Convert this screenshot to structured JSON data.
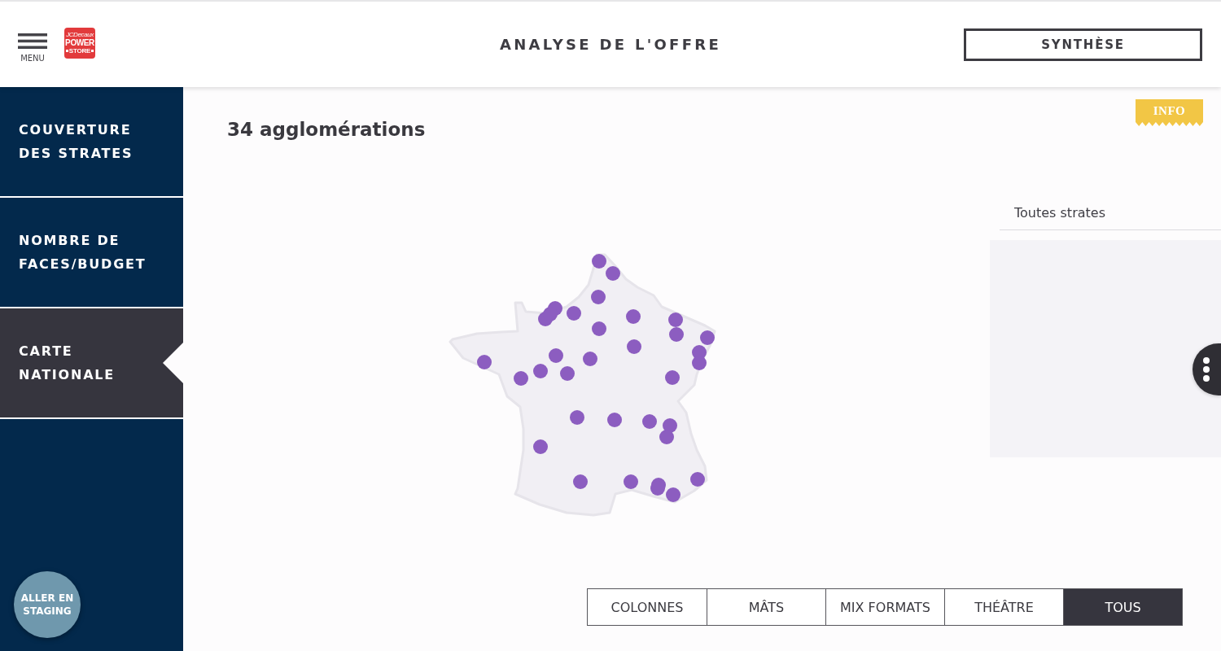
{
  "header": {
    "menu_label": "MENU",
    "logo": {
      "brand": "JCDecaux",
      "line_1": "POWER",
      "line_2": "STORE"
    },
    "title": "ANALYSE DE L'OFFRE",
    "action_button": "SYNTHÈSE"
  },
  "sidebar": {
    "items": [
      {
        "label": "COUVERTURE DES STRATES",
        "selected": false
      },
      {
        "label": "NOMBRE DE FACES/BUDGET",
        "selected": false
      },
      {
        "label": "CARTE NATIONALE",
        "selected": true
      }
    ],
    "staging_button": "ALLER EN STAGING"
  },
  "main": {
    "title": "34 agglomérations",
    "info_badge": "INFO",
    "strata_panel": {
      "heading": "Toutes strates"
    },
    "filters": [
      {
        "label": "COLONNES",
        "selected": false
      },
      {
        "label": "MÂTS",
        "selected": false
      },
      {
        "label": "MIX FORMATS",
        "selected": false
      },
      {
        "label": "THÉÂTRE",
        "selected": false
      },
      {
        "label": "TOUS",
        "selected": true
      }
    ]
  }
}
